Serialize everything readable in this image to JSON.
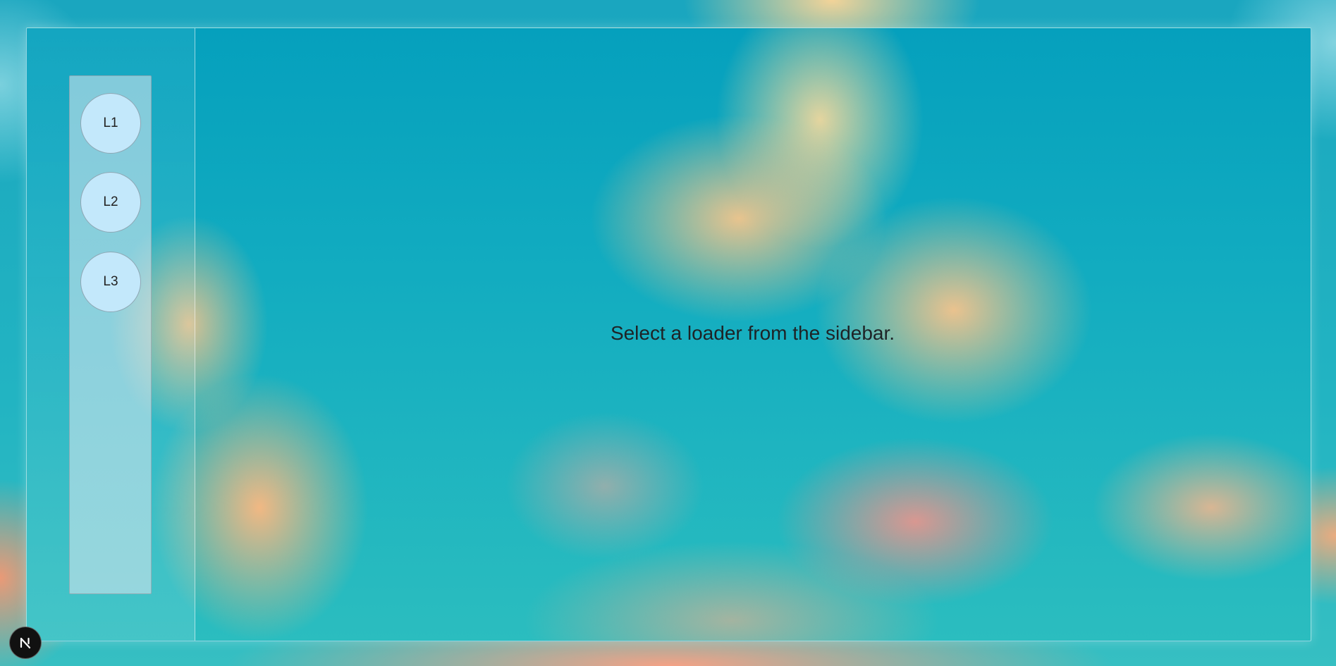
{
  "sidebar": {
    "loaders": [
      {
        "label": "L1"
      },
      {
        "label": "L2"
      },
      {
        "label": "L3"
      }
    ]
  },
  "main": {
    "message": "Select a loader from the sidebar."
  },
  "colors": {
    "loader_button_bg": "#c3e8fb",
    "background_teal": "#12acc0",
    "message_text": "#1e2326",
    "badge_bg": "#111111"
  },
  "icons": {
    "corner_badge": "nextjs-logo-icon"
  }
}
